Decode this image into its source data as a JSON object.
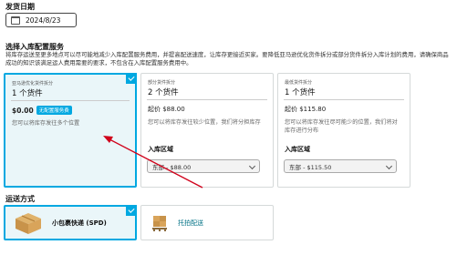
{
  "ship_date": {
    "label": "发货日期",
    "value": "2024/8/23"
  },
  "service": {
    "label": "选择入库配置服务",
    "description": "将库存运送至更多地点可以尽可能地减少入库配置服务费用，并提高配送速度，让库存更接近买家。要降低亚马逊优化货件拆分或部分货件拆分入库计划的费用，请确保商品成功的知识该满足运人费用需要的要求，不包含在入库配置服务费用中。"
  },
  "cards": [
    {
      "type": "亚马逊优化货件拆分",
      "title": "1 个货件",
      "price": "$0.00",
      "badge": "无配置服务费",
      "note": "您可以将库存发往多个位置",
      "selected": true
    },
    {
      "type": "部分货件拆分",
      "title": "2 个货件",
      "price": "起价 $88.00",
      "note": "您可以将库存发往较少位置，我们将分担库存",
      "region_label": "入库区域",
      "region_value": "东部 - $88.00"
    },
    {
      "type": "最低货件拆分",
      "title": "1 个货件",
      "price": "起价 $115.80",
      "note": "您可以将库存发往尽可能少的位置，我们将对库存进行分布",
      "region_label": "入库区域",
      "region_value": "东部 - $115.50"
    }
  ],
  "shipping": {
    "label": "运送方式",
    "options": [
      {
        "label": "小包裹快递 (SPD)",
        "icon": "box-icon",
        "selected": true
      },
      {
        "label": "托拍配送",
        "icon": "pallet-icon"
      }
    ]
  },
  "colors": {
    "accent": "#00a8e1",
    "selected_bg": "#eaf6f9",
    "arrow": "#d0021b",
    "link": "#007185"
  }
}
